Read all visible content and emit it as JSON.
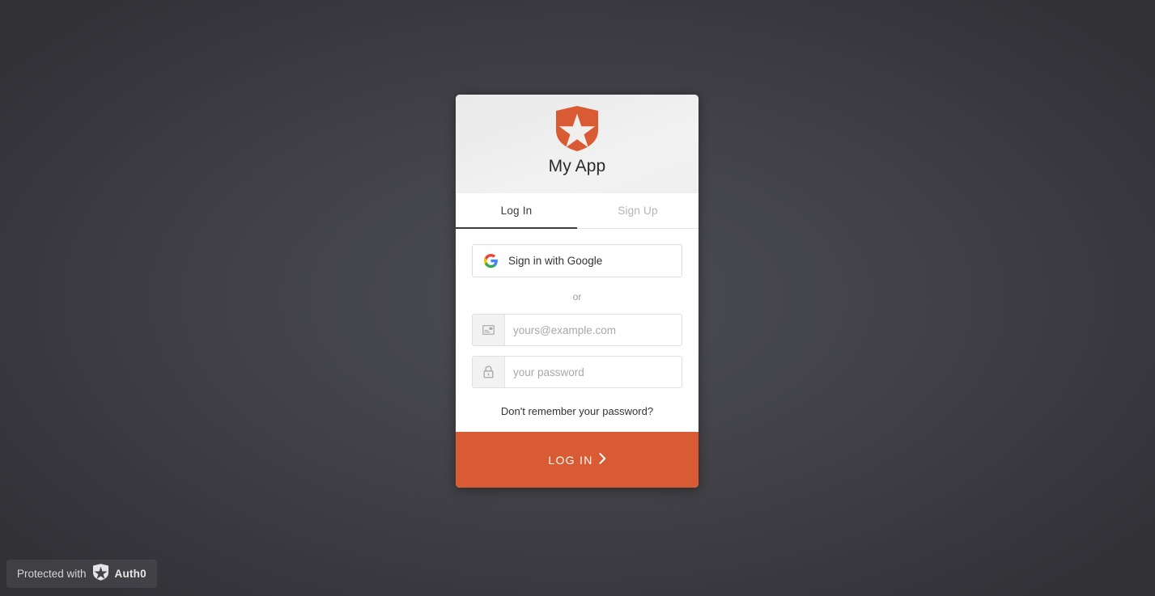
{
  "background": {
    "color_outer": "#313136",
    "color_inner": "#4a4a51"
  },
  "card": {
    "header": {
      "logo_icon": "auth0-shield-star-icon",
      "app_title": "My App",
      "logo_color": "#d95b33"
    },
    "tabs": [
      {
        "label": "Log In",
        "active": true
      },
      {
        "label": "Sign Up",
        "active": false
      }
    ],
    "social": {
      "icon": "google-g-icon",
      "label": "Sign in with Google"
    },
    "divider_label": "or",
    "fields": [
      {
        "name": "email",
        "icon": "email-envelope-icon",
        "placeholder": "yours@example.com",
        "value": ""
      },
      {
        "name": "password",
        "icon": "lock-padlock-icon",
        "placeholder": "your password",
        "value": ""
      }
    ],
    "forgot_password_label": "Don't remember your password?",
    "submit": {
      "label": "LOG IN",
      "chevron_icon": "chevron-right-icon",
      "color": "#d95b33"
    }
  },
  "badge": {
    "prefix_text": "Protected with",
    "icon": "auth0-shield-star-icon",
    "brand_text": "Auth0"
  }
}
